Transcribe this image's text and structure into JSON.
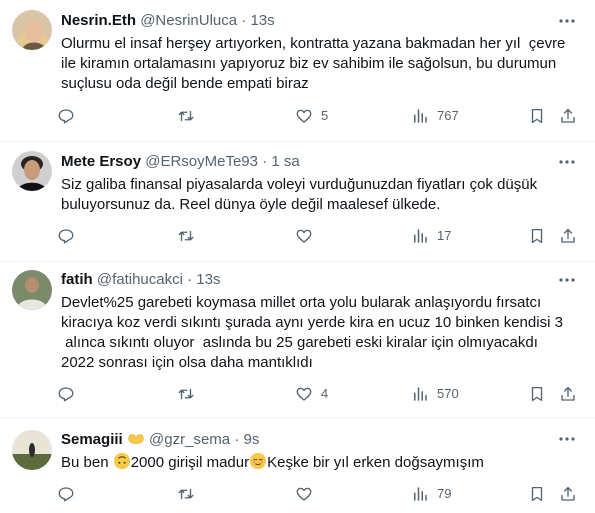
{
  "tweets": [
    {
      "name": "Nesrin.Eth",
      "handle": "@NesrinUluca",
      "sep": "·",
      "time": "13s",
      "text": "Olurmu el insaf herşey artıyorken, kontratta yazana bakmadan her yıl  çevre\nile kiramın ortalamasını yapıyoruz biz ev sahibim ile sağolsun, bu durumun\nsuçlusu oda değil bende empati biraz",
      "replies": "",
      "retweets": "",
      "likes": "5",
      "views": "767"
    },
    {
      "name": "Mete Ersoy",
      "handle": "@ERsoyMeTe93",
      "sep": "·",
      "time": "1 sa",
      "text": "Siz galiba finansal piyasalarda voleyi vurduğunuzdan fiyatları çok düşük\nbuluyorsunuz da. Reel dünya öyle değil maalesef ülkede.",
      "replies": "",
      "retweets": "",
      "likes": "",
      "views": "17"
    },
    {
      "name": "fatih",
      "handle": "@fatihucakci",
      "sep": "·",
      "time": "13s",
      "text": "Devlet%25 garebeti koymasa millet orta yolu bularak anlaşıyordu fırsatcı\nkiracıya koz verdi sıkıntı şurada aynı yerde kira en ucuz 10 binken kendisi 3\n alınca sıkıntı oluyor  aslında bu 25 garebeti eski kiralar için olmıyacakdı\n2022 sonrası için olsa daha mantıklıdı",
      "replies": "",
      "retweets": "",
      "likes": "4",
      "views": "570"
    },
    {
      "name": "Semagiii",
      "handle": "@gzr_sema",
      "sep": "·",
      "time": "9s",
      "text_part1": "Bu ben ",
      "text_part2": "2000 girişil madur",
      "text_part3": "Keşke bir yıl erken doğsaymışım",
      "replies": "",
      "retweets": "",
      "likes": "",
      "views": "79"
    }
  ],
  "icons": {
    "more": "more-horizontal-icon",
    "reply": "reply-icon",
    "retweet": "retweet-icon",
    "like": "heart-icon",
    "views": "analytics-icon",
    "bookmark": "bookmark-icon",
    "share": "share-icon"
  },
  "colors": {
    "text": "#0f1419",
    "secondary": "#536471",
    "separator": "#eff3f4"
  }
}
